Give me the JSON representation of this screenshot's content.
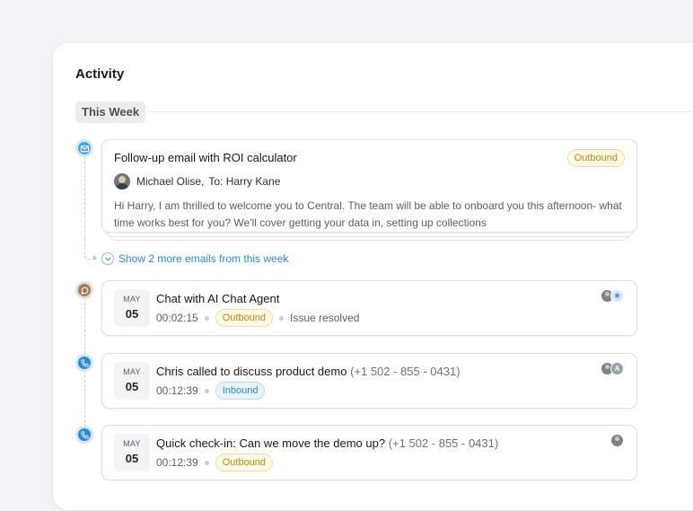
{
  "activity": {
    "title": "Activity",
    "period_label": "This Week"
  },
  "email": {
    "title": "Follow-up email with ROI calculator",
    "badge": "Outbound",
    "from": "Michael Olise,",
    "to": "To: Harry Kane",
    "body": "Hi Harry, I am thrilled to welcome you to Central. The team will be able to onboard  you this afternoon- what time works best for you? We'll cover getting your data in, setting up collections",
    "icon": "mail-icon"
  },
  "show_more": "Show 2 more emails from this week",
  "items": [
    {
      "month": "MAY",
      "day": "05",
      "title": "Chat with AI Chat Agent",
      "phone": "",
      "duration": "00:02:15",
      "badge": "Outbound",
      "status": "Issue resolved",
      "icon": "chat-icon",
      "avatar_ai_glyph": "✺"
    },
    {
      "month": "MAY",
      "day": "05",
      "title": "Chris called to discuss product demo",
      "phone": "(+1 502 - 855 - 0431)",
      "duration": "00:12:39",
      "badge": "Inbound",
      "icon": "phone-icon",
      "avatar_letter": "A"
    },
    {
      "month": "MAY",
      "day": "05",
      "title": "Quick check-in: Can we move the demo up?",
      "phone": "(+1 502 - 855 - 0431)",
      "duration": "00:12:39",
      "badge": "Outbound",
      "icon": "phone-icon"
    }
  ],
  "colors": {
    "accent_blue": "#2d8ad6",
    "chat_dot": "#a07c61",
    "outbound_text": "#b98a13",
    "inbound_text": "#2d8ad6"
  }
}
